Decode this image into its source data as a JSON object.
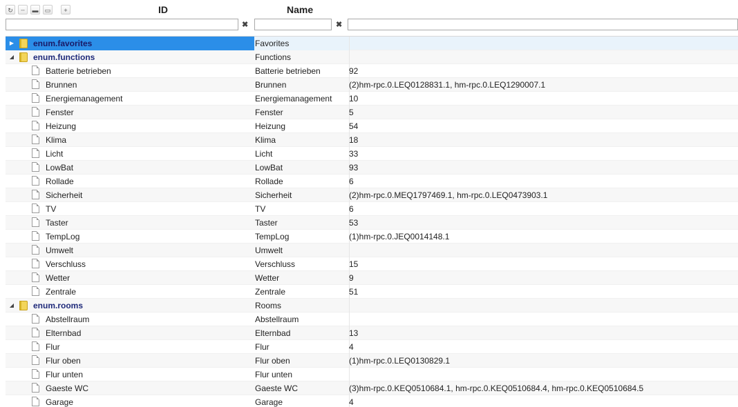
{
  "columns": {
    "id": "ID",
    "name": "Name"
  },
  "toolbar": {
    "buttons": [
      {
        "name": "refresh-icon",
        "glyph": "↻"
      },
      {
        "name": "collapse-icon",
        "glyph": "┄"
      },
      {
        "name": "folder-closed-icon",
        "glyph": "▬"
      },
      {
        "name": "folder-open-icon",
        "glyph": "▭"
      },
      {
        "name": "add-icon",
        "glyph": "+"
      }
    ]
  },
  "filters": {
    "id_value": "",
    "name_value": "",
    "value_value": "",
    "clear_glyph": "✖"
  },
  "rows": [
    {
      "type": "folder",
      "expander": "▶",
      "id": "enum.favorites",
      "name": "Favorites",
      "value": "",
      "selected": true
    },
    {
      "type": "folder",
      "expander": "◢",
      "id": "enum.functions",
      "name": "Functions",
      "value": ""
    },
    {
      "type": "leaf",
      "id": "Batterie betrieben",
      "name": "Batterie betrieben",
      "value": "92"
    },
    {
      "type": "leaf",
      "id": "Brunnen",
      "name": "Brunnen",
      "value": "(2)hm-rpc.0.LEQ0128831.1, hm-rpc.0.LEQ1290007.1"
    },
    {
      "type": "leaf",
      "id": "Energiemanagement",
      "name": "Energiemanagement",
      "value": "10"
    },
    {
      "type": "leaf",
      "id": "Fenster",
      "name": "Fenster",
      "value": "5"
    },
    {
      "type": "leaf",
      "id": "Heizung",
      "name": "Heizung",
      "value": "54"
    },
    {
      "type": "leaf",
      "id": "Klima",
      "name": "Klima",
      "value": "18"
    },
    {
      "type": "leaf",
      "id": "Licht",
      "name": "Licht",
      "value": "33"
    },
    {
      "type": "leaf",
      "id": "LowBat",
      "name": "LowBat",
      "value": "93"
    },
    {
      "type": "leaf",
      "id": "Rollade",
      "name": "Rollade",
      "value": "6"
    },
    {
      "type": "leaf",
      "id": "Sicherheit",
      "name": "Sicherheit",
      "value": "(2)hm-rpc.0.MEQ1797469.1, hm-rpc.0.LEQ0473903.1"
    },
    {
      "type": "leaf",
      "id": "TV",
      "name": "TV",
      "value": "6"
    },
    {
      "type": "leaf",
      "id": "Taster",
      "name": "Taster",
      "value": "53"
    },
    {
      "type": "leaf",
      "id": "TempLog",
      "name": "TempLog",
      "value": "(1)hm-rpc.0.JEQ0014148.1"
    },
    {
      "type": "leaf",
      "id": "Umwelt",
      "name": "Umwelt",
      "value": ""
    },
    {
      "type": "leaf",
      "id": "Verschluss",
      "name": "Verschluss",
      "value": "15"
    },
    {
      "type": "leaf",
      "id": "Wetter",
      "name": "Wetter",
      "value": "9"
    },
    {
      "type": "leaf",
      "id": "Zentrale",
      "name": "Zentrale",
      "value": "51"
    },
    {
      "type": "folder",
      "expander": "◢",
      "id": "enum.rooms",
      "name": "Rooms",
      "value": ""
    },
    {
      "type": "leaf",
      "id": "Abstellraum",
      "name": "Abstellraum",
      "value": ""
    },
    {
      "type": "leaf",
      "id": "Elternbad",
      "name": "Elternbad",
      "value": "13"
    },
    {
      "type": "leaf",
      "id": "Flur",
      "name": "Flur",
      "value": "4"
    },
    {
      "type": "leaf",
      "id": "Flur oben",
      "name": "Flur oben",
      "value": "(1)hm-rpc.0.LEQ0130829.1"
    },
    {
      "type": "leaf",
      "id": "Flur unten",
      "name": "Flur unten",
      "value": ""
    },
    {
      "type": "leaf",
      "id": "Gaeste WC",
      "name": "Gaeste WC",
      "value": "(3)hm-rpc.0.KEQ0510684.1, hm-rpc.0.KEQ0510684.4, hm-rpc.0.KEQ0510684.5"
    },
    {
      "type": "leaf",
      "id": "Garage",
      "name": "Garage",
      "value": "4"
    }
  ]
}
